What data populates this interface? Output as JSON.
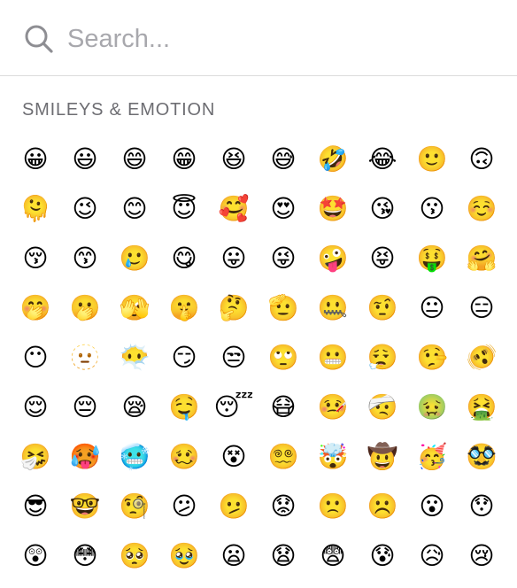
{
  "search": {
    "placeholder": "Search..."
  },
  "section": {
    "title": "SMILEYS & EMOTION"
  },
  "emojis": [
    "😀",
    "😃",
    "😄",
    "😁",
    "😆",
    "😅",
    "🤣",
    "😂",
    "🙂",
    "🙃",
    "🫠",
    "😉",
    "😊",
    "😇",
    "🥰",
    "😍",
    "🤩",
    "😘",
    "😗",
    "☺️",
    "😚",
    "😙",
    "🥲",
    "😋",
    "😛",
    "😜",
    "🤪",
    "😝",
    "🤑",
    "🤗",
    "🤭",
    "🫢",
    "🫣",
    "🤫",
    "🤔",
    "🫡",
    "🤐",
    "🤨",
    "😐",
    "😑",
    "😶",
    "🫥",
    "😶‍🌫️",
    "😏",
    "😒",
    "🙄",
    "😬",
    "😮‍💨",
    "🤥",
    "🫨",
    "😌",
    "😔",
    "😪",
    "🤤",
    "😴",
    "😷",
    "🤒",
    "🤕",
    "🤢",
    "🤮",
    "🤧",
    "🥵",
    "🥶",
    "🥴",
    "😵",
    "😵‍💫",
    "🤯",
    "🤠",
    "🥳",
    "🥸",
    "😎",
    "🤓",
    "🧐",
    "😕",
    "🫤",
    "😟",
    "🙁",
    "☹️",
    "😮",
    "😯",
    "😲",
    "😳",
    "🥺",
    "🥹",
    "😦",
    "😧",
    "😨",
    "😰",
    "😥",
    "😢"
  ],
  "colors": {
    "placeholder": "#a8a8ad",
    "section_title": "#6d6d72",
    "divider": "#dcdcdc"
  }
}
